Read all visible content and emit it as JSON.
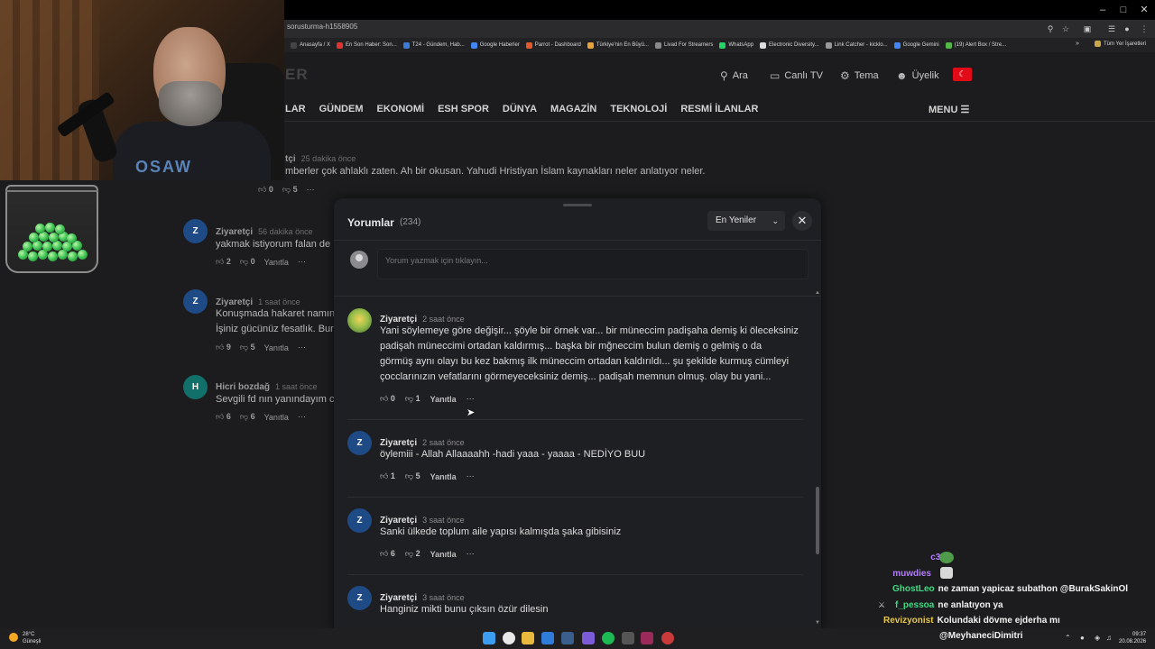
{
  "browser": {
    "url": "sorusturma-h1558905",
    "bookmarks": [
      "Anasayfa / X",
      "En Son Haber: Son...",
      "T24 - Gündem, Hab...",
      "Google Haberler",
      "Parrot - Dashboard",
      "Türkiye'nin En Büyü...",
      "Livad For Streamers",
      "WhatsApp",
      "Electronic Diversity...",
      "Link Catcher - kicklo...",
      "Google Gemini",
      "(19) Alert Box / Stre..."
    ],
    "all_bookmarks": "Tüm Yer İşaretleri"
  },
  "site": {
    "logo": "ER",
    "header": {
      "search": "Ara",
      "live_tv": "Canlı TV",
      "theme": "Tema",
      "membership": "Üyelik"
    },
    "nav": [
      "LAR",
      "GÜNDEM",
      "EKONOMİ",
      "ESH SPOR",
      "DÜNYA",
      "MAGAZİN",
      "TEKNOLOJİ",
      "RESMİ İLANLAR"
    ],
    "menu": "MENU"
  },
  "background_comments": [
    {
      "name": "tçi",
      "time": "25 dakika önce",
      "text": "mberler çok ahlaklı zaten. Ah bir okusan. Yahudi Hristiyan İslam kaynakları neler anlatıyor neler.",
      "likes": "0",
      "dislikes": "5"
    },
    {
      "initial": "Z",
      "name": "Ziyaretçi",
      "time": "56 dakika önce",
      "text": "yakmak istiyorum falan de",
      "likes": "2",
      "dislikes": "0",
      "reply": "Yanıtla"
    },
    {
      "initial": "Z",
      "name": "Ziyaretçi",
      "time": "1 saat önce",
      "text": "Konuşmada hakaret namın",
      "text2": "İşiniz gücünüz fesatlık. Bur",
      "likes": "9",
      "dislikes": "5",
      "reply": "Yanıtla"
    },
    {
      "initial": "H",
      "name": "Hicri bozdağ",
      "time": "1 saat önce",
      "text": "Sevgili fd nın yanındayım c",
      "likes": "6",
      "dislikes": "6",
      "reply": "Yanıtla"
    }
  ],
  "modal": {
    "title": "Yorumlar",
    "count": "(234)",
    "sort": "En Yeniler",
    "input_placeholder": "Yorum yazmak için tıklayın...",
    "comments": [
      {
        "name": "Ziyaretçi",
        "time": "2 saat önce",
        "lines": [
          "Yani söylemeye göre değişir... şöyle bir örnek var... bir müneccim padişaha demiş ki öleceksiniz",
          "padişah müneccimi ortadan kaldırmış... başka bir mğneccim bulun demiş o gelmiş o da",
          "görmüş aynı olayı bu kez bakmış ilk müneccim ortadan kaldırıldı... şu şekilde kurmuş cümleyi",
          "çocclarınızın vefatlarını görmeyeceksiniz demiş... padişah memnun olmuş. olay bu yani..."
        ],
        "likes": "0",
        "dislikes": "1",
        "reply": "Yanıtla"
      },
      {
        "initial": "Z",
        "name": "Ziyaretçi",
        "time": "2 saat önce",
        "lines": [
          "öylemiii - Allah Allaaaahh -hadi yaaa - yaaaa - NEDİYO BUU"
        ],
        "likes": "1",
        "dislikes": "5",
        "reply": "Yanıtla"
      },
      {
        "initial": "Z",
        "name": "Ziyaretçi",
        "time": "3 saat önce",
        "lines": [
          "Sanki ülkede toplum aile yapısı kalmışda şaka gibisiniz"
        ],
        "likes": "6",
        "dislikes": "2",
        "reply": "Yanıtla"
      },
      {
        "initial": "Z",
        "name": "Ziyaretçi",
        "time": "3 saat önce",
        "lines": [
          "Hanginiz mikti bunu çıksın özür dilesin"
        ]
      }
    ]
  },
  "chat": [
    {
      "user": "c3nk",
      "message": "",
      "color": "#b37cff"
    },
    {
      "user": "muwdies",
      "message": "",
      "color": "#b37cff"
    },
    {
      "user": "GhostLeo",
      "message": "ne zaman yapicaz subathon @BurakSakinOl",
      "color": "#3ddc84"
    },
    {
      "user": "f_pessoa",
      "message": "ne anlatıyon ya",
      "color": "#3ddc84"
    },
    {
      "user": "Revizyonist",
      "message": "Kolundaki dövme ejderha mı",
      "color": "#e6c84a"
    },
    {
      "user": "",
      "message": "@MeyhaneciDimitri",
      "color": "#f2f2f2"
    }
  ],
  "webcam": {
    "shirt_text": "OSAW"
  },
  "taskbar": {
    "weather_temp": "28°C",
    "weather_desc": "Güneşli",
    "time": "09:37",
    "date": "20.08.2026"
  },
  "colors": {
    "accent_blue": "#1e4a86",
    "accent_teal": "#12706b",
    "flag_red": "#e30a17"
  }
}
